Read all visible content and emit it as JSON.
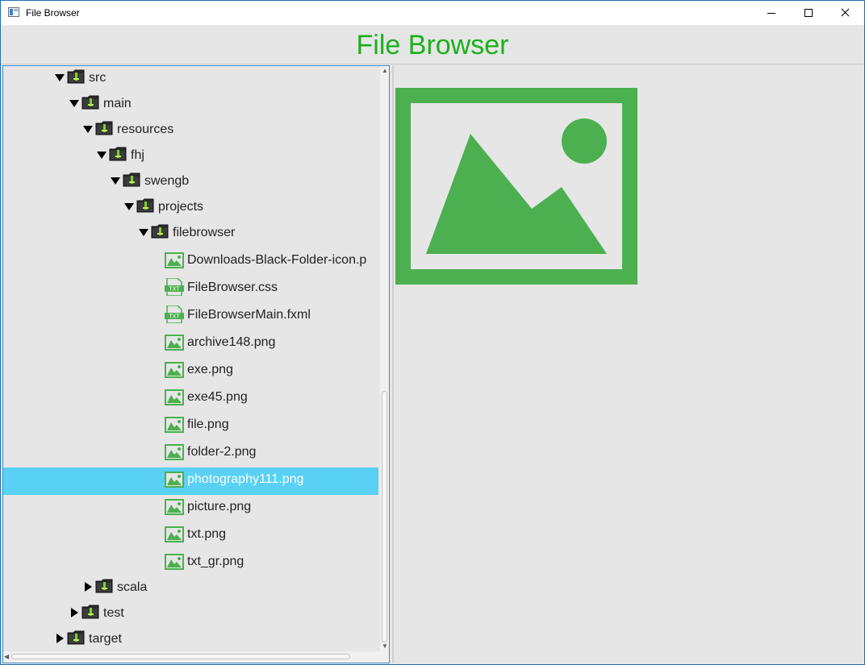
{
  "window": {
    "title": "File Browser"
  },
  "header": {
    "title": "File Browser"
  },
  "tree": {
    "rows": [
      {
        "label": "src",
        "type": "folder",
        "expanded": true
      },
      {
        "label": "main",
        "type": "folder",
        "expanded": true
      },
      {
        "label": "resources",
        "type": "folder",
        "expanded": true
      },
      {
        "label": "fhj",
        "type": "folder",
        "expanded": true
      },
      {
        "label": "swengb",
        "type": "folder",
        "expanded": true
      },
      {
        "label": "projects",
        "type": "folder",
        "expanded": true
      },
      {
        "label": "filebrowser",
        "type": "folder",
        "expanded": true
      },
      {
        "label": "Downloads-Black-Folder-icon.p",
        "type": "image"
      },
      {
        "label": "FileBrowser.css",
        "type": "text"
      },
      {
        "label": "FileBrowserMain.fxml",
        "type": "text"
      },
      {
        "label": "archive148.png",
        "type": "image"
      },
      {
        "label": "exe.png",
        "type": "image"
      },
      {
        "label": "exe45.png",
        "type": "image"
      },
      {
        "label": "file.png",
        "type": "image"
      },
      {
        "label": "folder-2.png",
        "type": "image"
      },
      {
        "label": "photography111.png",
        "type": "image",
        "selected": true
      },
      {
        "label": "picture.png",
        "type": "image"
      },
      {
        "label": "txt.png",
        "type": "image"
      },
      {
        "label": "txt_gr.png",
        "type": "image"
      },
      {
        "label": "scala",
        "type": "folder",
        "expanded": false
      },
      {
        "label": "test",
        "type": "folder",
        "expanded": false
      },
      {
        "label": "target",
        "type": "folder",
        "expanded": false
      }
    ],
    "text_icon_label": "TXT"
  },
  "preview": {
    "icon": "image-placeholder-icon"
  },
  "colors": {
    "accent_green": "#4caf50",
    "title_green": "#1bb01b",
    "selection": "#58d1f4",
    "background": "#e6e6e6"
  }
}
